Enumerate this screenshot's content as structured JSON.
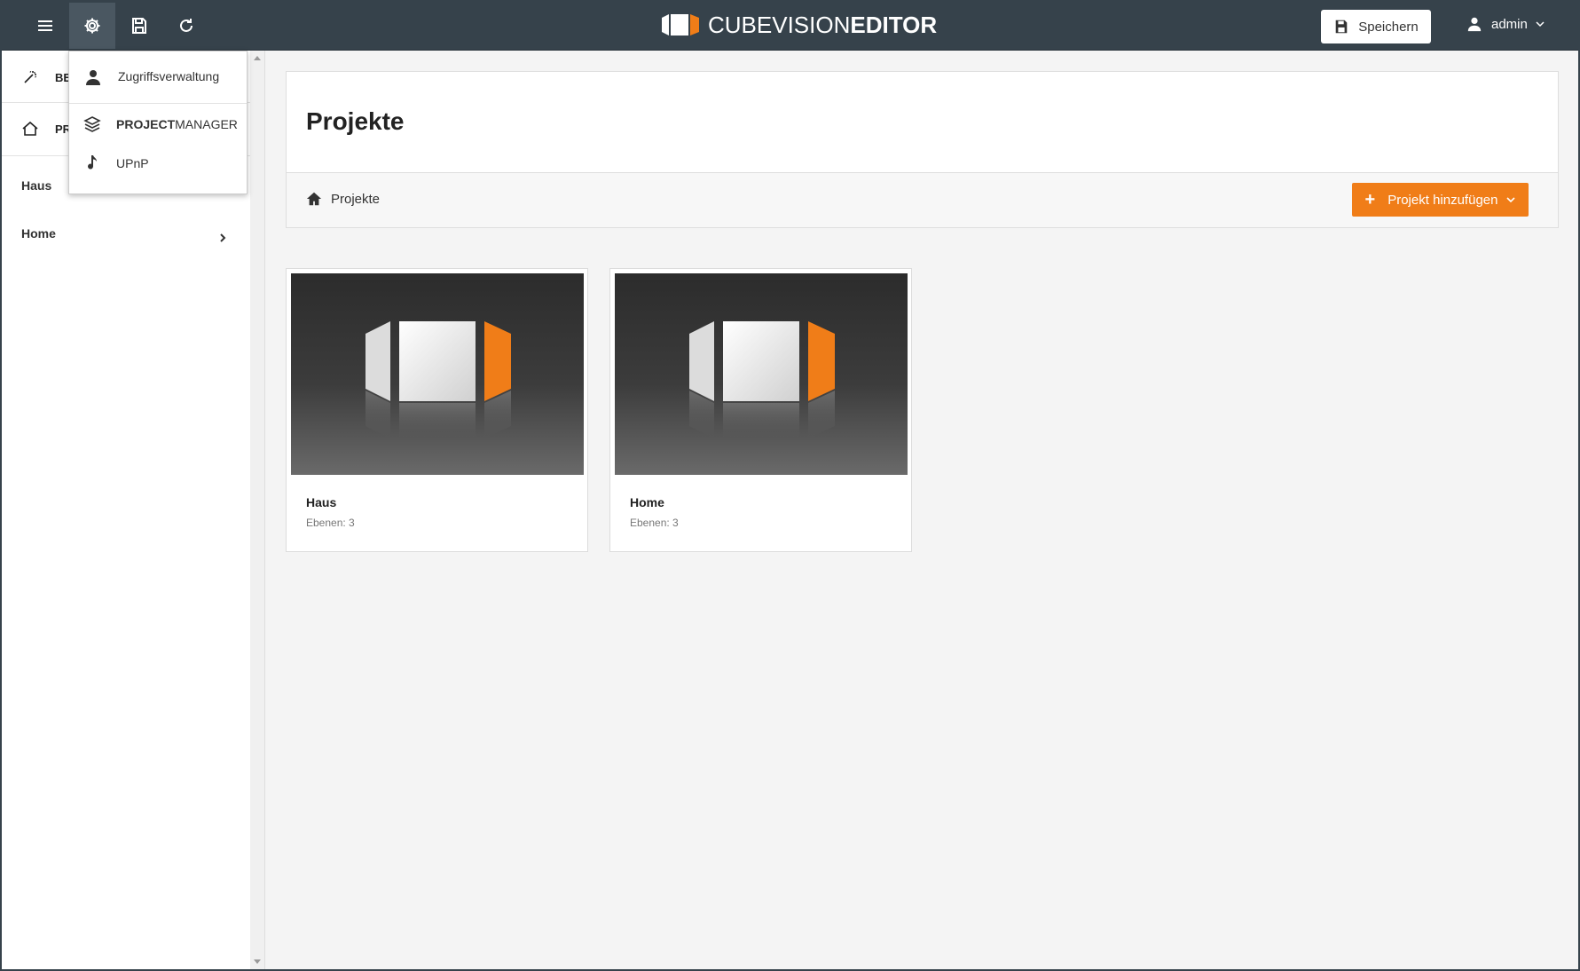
{
  "topbar": {
    "brand_prefix": "CUBEVISION",
    "brand_suffix": "EDITOR",
    "save_label": "Speichern",
    "user_label": "admin",
    "icons": [
      "menu-icon",
      "gear-icon",
      "floppy-disk-icon",
      "refresh-icon"
    ]
  },
  "sidebar": {
    "rows": [
      {
        "label": "BE",
        "icon": "magic-wand-icon"
      },
      {
        "label": "PR",
        "icon": "home-outline-icon"
      }
    ],
    "items": [
      {
        "label": "Haus"
      },
      {
        "label": "Home"
      }
    ]
  },
  "settings_menu": {
    "items": [
      {
        "label": "Zugriffsverwaltung",
        "icon": "user-icon"
      },
      {
        "label_bold": "PROJECT",
        "label_rest": "MANAGER",
        "icon": "layers-icon"
      },
      {
        "label": "UPnP",
        "icon": "music-note-icon"
      }
    ]
  },
  "main": {
    "title": "Projekte",
    "breadcrumb": "Projekte",
    "add_button": "Projekt hinzufügen",
    "projects": [
      {
        "name": "Haus",
        "meta": "Ebenen: 3"
      },
      {
        "name": "Home",
        "meta": "Ebenen: 3"
      }
    ]
  },
  "colors": {
    "topbar": "#36424b",
    "accent": "#f07d18",
    "background": "#f4f4f4"
  }
}
